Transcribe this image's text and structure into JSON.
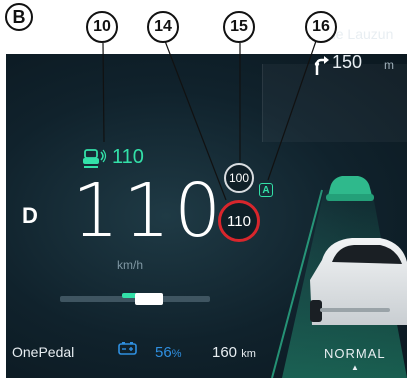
{
  "figure_label": "B",
  "callouts": [
    "10",
    "14",
    "15",
    "16"
  ],
  "navigation": {
    "street": "Av de Lauzun",
    "distance": "150",
    "unit": "m",
    "icon": "turn-right-arrow-icon"
  },
  "cruise": {
    "icon": "vehicle-following-icon",
    "set_speed": "110"
  },
  "gear": "D",
  "speed": {
    "value": "110",
    "unit": "km/h"
  },
  "speed_limit": {
    "current_limit": "110",
    "recognized_sign": "100",
    "auto_badge": "A"
  },
  "one_pedal": {
    "label": "OnePedal"
  },
  "battery": {
    "icon": "battery-icon",
    "percent": "56",
    "percent_unit": "%",
    "color": "#2f8fe0"
  },
  "range": {
    "value": "160",
    "unit": "km"
  },
  "drive_mode": "NORMAL",
  "colors": {
    "accent": "#33e0a8",
    "limit_ring": "#d8262c",
    "background": "#10222c"
  }
}
